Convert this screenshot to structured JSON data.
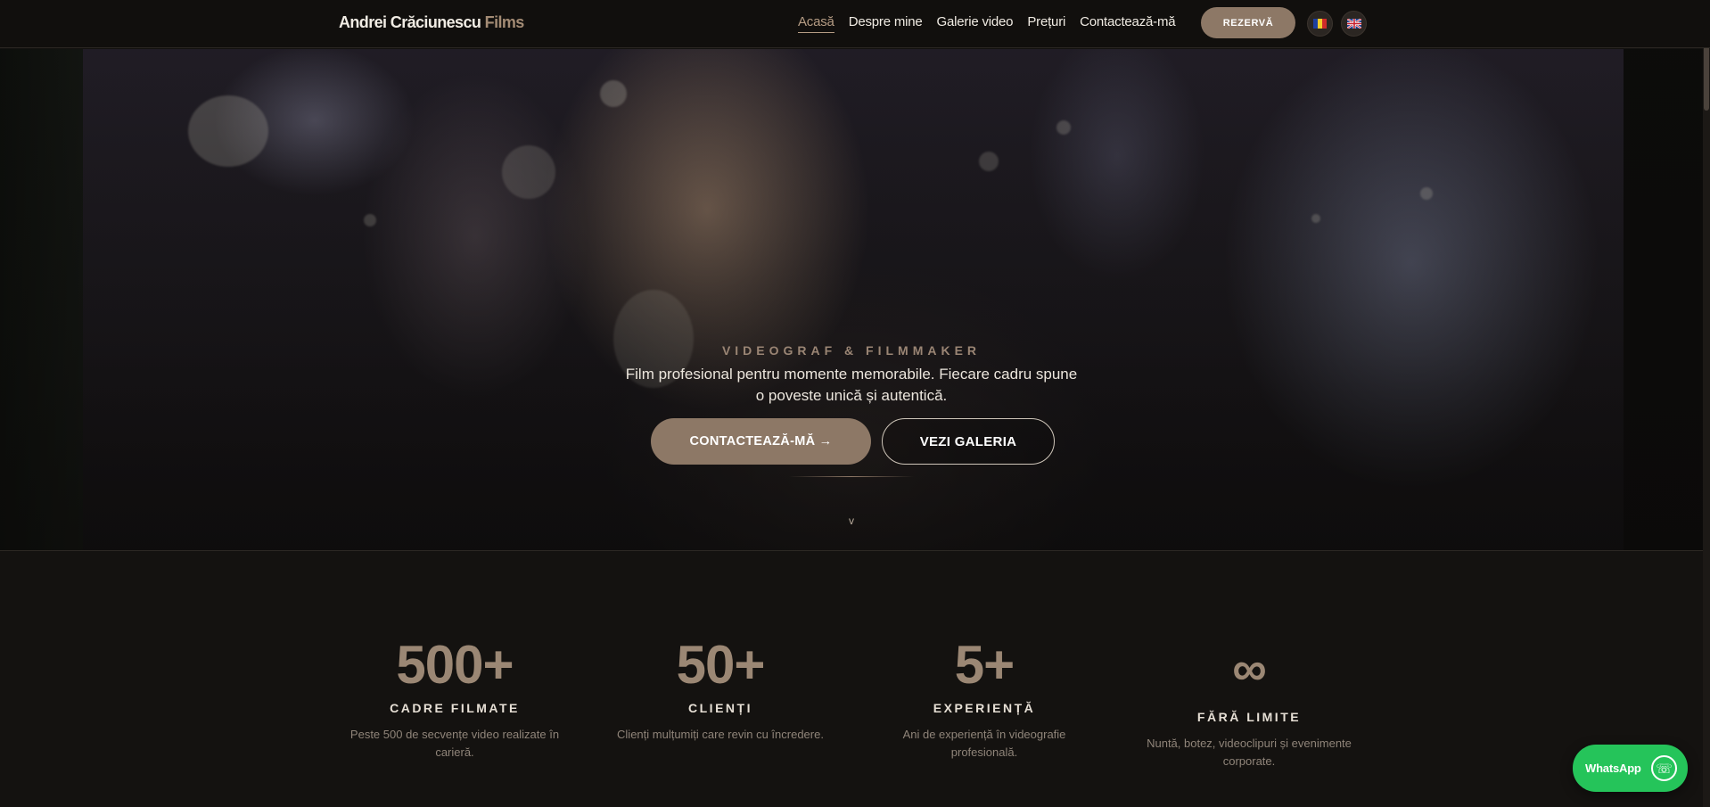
{
  "nav": {
    "brand_main": "Andrei Crăciunescu",
    "brand_accent": "Films",
    "links": [
      {
        "label": "Acasă",
        "active": true
      },
      {
        "label": "Despre mine"
      },
      {
        "label": "Galerie video"
      },
      {
        "label": "Prețuri"
      },
      {
        "label": "Contactează-mă"
      }
    ],
    "cta": "REZERVĂ",
    "languages": [
      {
        "code": "RO",
        "icon": "romania-flag-icon"
      },
      {
        "code": "EN",
        "icon": "uk-flag-icon"
      }
    ]
  },
  "hero": {
    "eyebrow": "VIDEOGRAF & FILMMAKER",
    "subtitle": "Film profesional pentru momente memorabile. Fiecare cadru spune o poveste unică și autentică.",
    "primary_button": "CONTACTEAZĂ-MĂ →",
    "secondary_button": "VEZI GALERIA",
    "scroll_cue": "v"
  },
  "stats": [
    {
      "value": "500+",
      "title": "CADRE FILMATE",
      "desc": "Peste 500 de secvențe video realizate în carieră."
    },
    {
      "value": "50+",
      "title": "CLIENȚI",
      "desc": "Clienți mulțumiți care revin cu încredere."
    },
    {
      "value": "5+",
      "title": "EXPERIENȚĂ",
      "desc": "Ani de experiență în videografie profesională."
    },
    {
      "value": "∞",
      "title": "FĂRĂ LIMITE",
      "desc": "Nuntă, botez, videoclipuri și evenimente corporate."
    }
  ],
  "whatsapp": {
    "label": "WhatsApp",
    "icon": "phone-icon"
  },
  "colors": {
    "accent": "#8d7866",
    "background": "#141210",
    "whatsapp": "#25c45a"
  }
}
